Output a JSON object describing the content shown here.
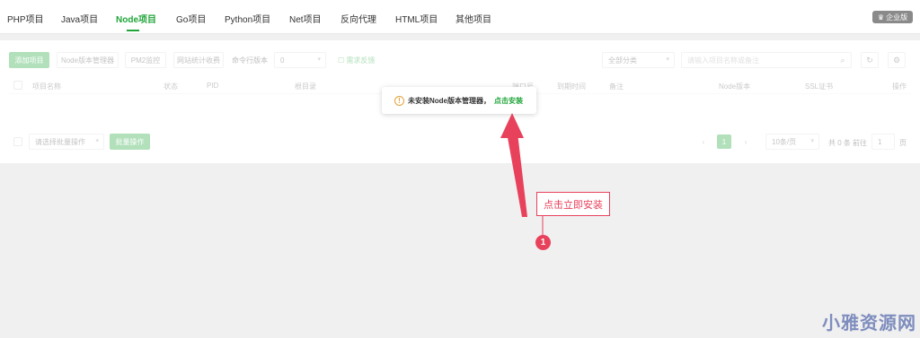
{
  "tabs": [
    {
      "label": "PHP项目"
    },
    {
      "label": "Java项目"
    },
    {
      "label": "Node项目"
    },
    {
      "label": "Go项目"
    },
    {
      "label": "Python项目"
    },
    {
      "label": "Net项目"
    },
    {
      "label": "反向代理"
    },
    {
      "label": "HTML项目"
    },
    {
      "label": "其他项目"
    }
  ],
  "active_tab": "Node项目",
  "edition_badge": "企业版",
  "toolbar": {
    "add_project": "添加项目",
    "node_version_manager": "Node版本管理器",
    "pm2_monitor": "PM2监控",
    "site_stats": "网站统计收费",
    "cli_version_label": "命令行版本",
    "cli_version_value": "0",
    "feedback_link": "需求反馈",
    "category_select": "全部分类",
    "search_placeholder": "请输入项目名称或备注"
  },
  "table": {
    "headers": [
      "项目名称",
      "状态",
      "PID",
      "根目录",
      "端口号",
      "到期时间",
      "备注",
      "Node版本",
      "SSL证书",
      "操作"
    ]
  },
  "footer": {
    "batch_select": "请选择批量操作",
    "batch_button": "批量操作",
    "page_current": "1",
    "page_size": "10条/页",
    "total": "共 0 条",
    "goto_label": "前往",
    "goto_value": "1",
    "page_unit": "页"
  },
  "tooltip": {
    "message": "未安装Node版本管理器，",
    "install_link": "点击安装"
  },
  "annotation": {
    "callout_text": "点击立即安装",
    "marker_number": "1"
  },
  "watermark": "小雅资源网",
  "colors": {
    "accent": "#20a53a",
    "annotation": "#e8415b",
    "warning": "#e6a23c"
  }
}
